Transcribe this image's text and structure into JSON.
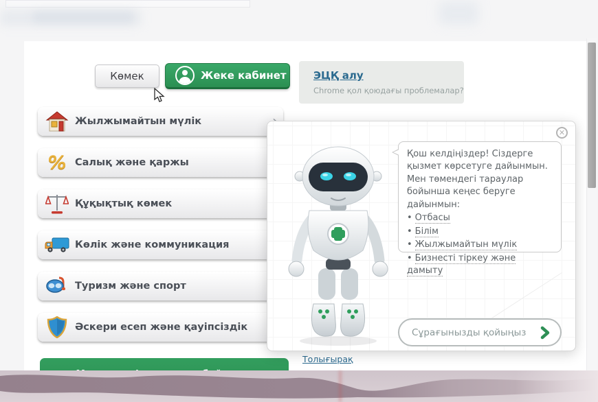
{
  "header": {
    "help_button": "Көмек",
    "cabinet_button": "Жеке кабинет",
    "esignature": {
      "link": "ЭЦҚ алу",
      "subtitle": "Chrome қол қоюдағы проблемалар?"
    }
  },
  "sidebar": {
    "items": [
      {
        "label": "Жылжымайтын мүлік",
        "icon": "house-icon"
      },
      {
        "label": "Салық және қаржы",
        "icon": "percent-icon"
      },
      {
        "label": "Құқықтық көмек",
        "icon": "scales-icon"
      },
      {
        "label": "Көлік және коммуникация",
        "icon": "truck-icon"
      },
      {
        "label": "Туризм және спорт",
        "icon": "diving-mask-icon"
      },
      {
        "label": "Әскери есеп және қауіпсіздік",
        "icon": "shield-icon"
      }
    ],
    "chevron": "›",
    "footer_button": "Мемлекеттік органдар бойынша қызметтер"
  },
  "chat": {
    "greeting": "Қош келдіңіздер! Сіздерге қызмет көрсетуге дайынмын. Мен төмендегі тараулар бойынша кеңес беруге дайынмын:",
    "bullet": "•",
    "topics": [
      "Отбасы",
      "Білім",
      "Жылжымайтын мүлік",
      "Бизнесті тіркеу және дамыту"
    ],
    "input_placeholder": "Сұрағынызды қойыңыз",
    "close_glyph": "✕"
  },
  "footer": {
    "more_link": "Толығырақ"
  },
  "colors": {
    "accent_green": "#2f9e5c",
    "link_blue": "#2b6a8f",
    "band_mauve": "#9a8793",
    "panel_white": "#ffffff"
  }
}
